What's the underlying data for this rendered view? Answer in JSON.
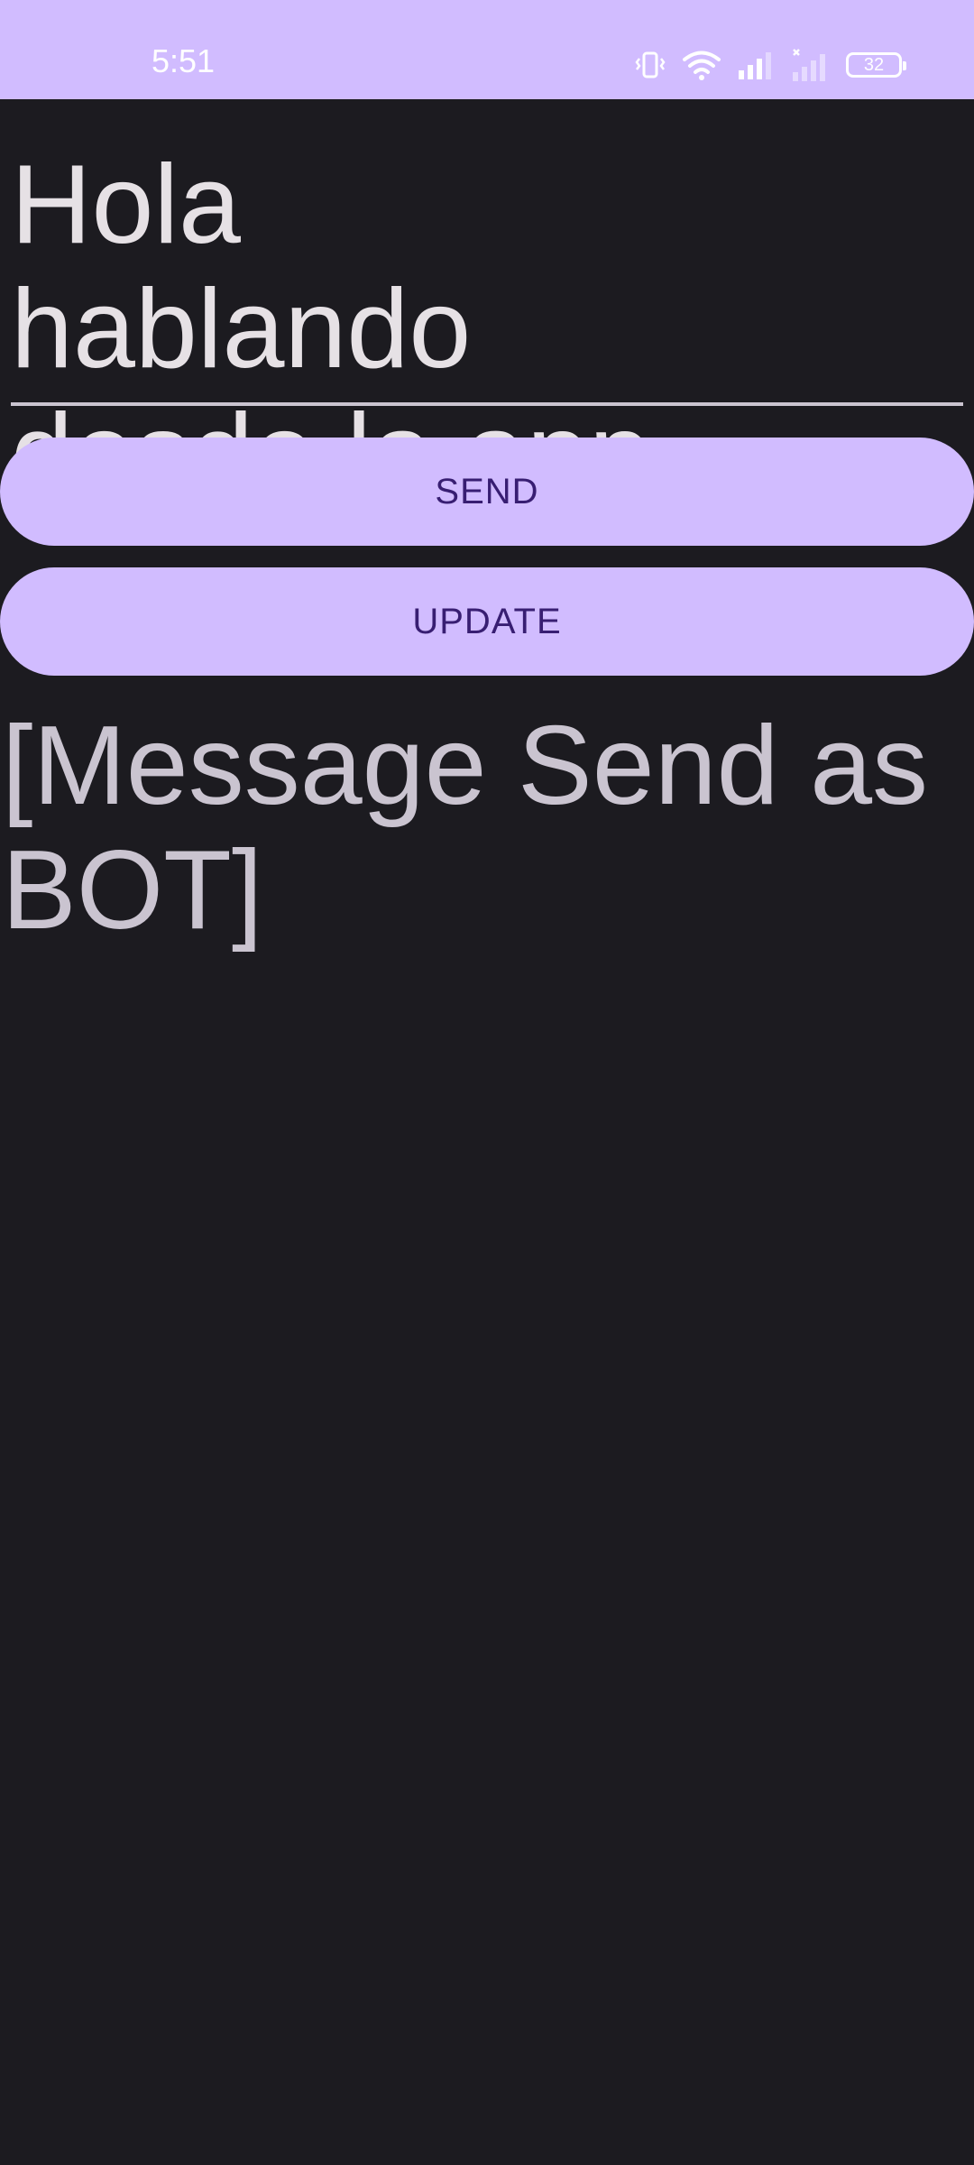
{
  "status_bar": {
    "time": "5:51",
    "battery_level": "32",
    "background_color": "#d1bcff",
    "icons": [
      "vibrate-icon",
      "wifi-icon",
      "signal-icon",
      "signal-no-service-icon",
      "battery-icon"
    ]
  },
  "message_field": {
    "value": "Hola hablando desde la app"
  },
  "buttons": {
    "send_label": "SEND",
    "update_label": "UPDATE",
    "color": "#d1bcff",
    "text_color": "#381e72"
  },
  "status_message": "[Message Send as BOT]",
  "colors": {
    "background": "#1c1b20",
    "text_primary": "#e6e1e5",
    "text_secondary": "#cac4d0"
  }
}
